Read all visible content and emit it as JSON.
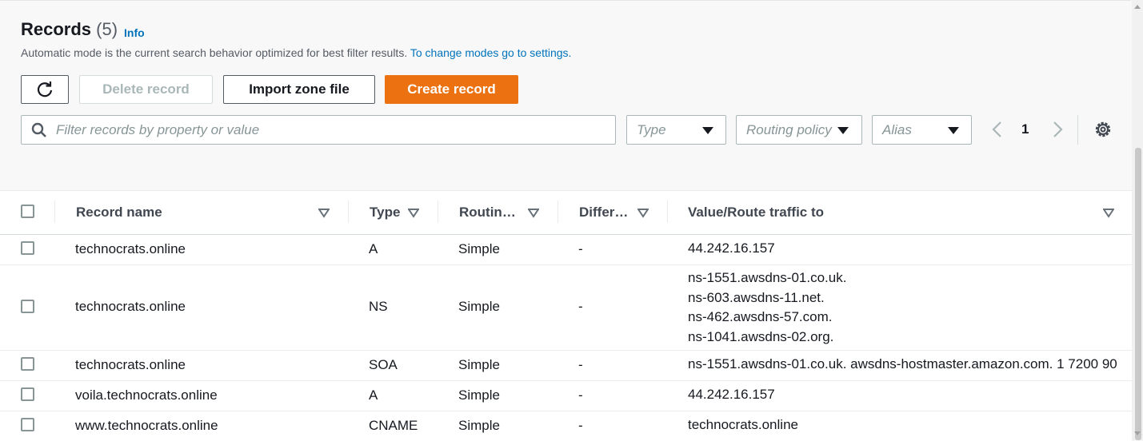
{
  "header": {
    "title": "Records",
    "count": "(5)",
    "info": "Info",
    "description": "Automatic mode is the current search behavior optimized for best filter results.",
    "settings_link": "To change modes go to settings."
  },
  "toolbar": {
    "refresh_icon": "refresh-icon",
    "delete_label": "Delete record",
    "import_label": "Import zone file",
    "create_label": "Create record"
  },
  "filters": {
    "search_placeholder": "Filter records by property or value",
    "type_placeholder": "Type",
    "routing_placeholder": "Routing policy",
    "alias_placeholder": "Alias"
  },
  "pagination": {
    "current_page": "1"
  },
  "colors": {
    "primary": "#ec7211",
    "link": "#0073bb",
    "disabled": "#aab7b8"
  },
  "table": {
    "columns": [
      "Record name",
      "Type",
      "Routin…",
      "Differ…",
      "Value/Route traffic to"
    ],
    "rows": [
      {
        "name": "technocrats.online",
        "type": "A",
        "routing": "Simple",
        "differ": "-",
        "values": [
          "44.242.16.157"
        ]
      },
      {
        "name": "technocrats.online",
        "type": "NS",
        "routing": "Simple",
        "differ": "-",
        "values": [
          "ns-1551.awsdns-01.co.uk.",
          "ns-603.awsdns-11.net.",
          "ns-462.awsdns-57.com.",
          "ns-1041.awsdns-02.org."
        ]
      },
      {
        "name": "technocrats.online",
        "type": "SOA",
        "routing": "Simple",
        "differ": "-",
        "values": [
          "ns-1551.awsdns-01.co.uk. awsdns-hostmaster.amazon.com. 1 7200 90"
        ]
      },
      {
        "name": "voila.technocrats.online",
        "type": "A",
        "routing": "Simple",
        "differ": "-",
        "values": [
          "44.242.16.157"
        ]
      },
      {
        "name": "www.technocrats.online",
        "type": "CNAME",
        "routing": "Simple",
        "differ": "-",
        "values": [
          "technocrats.online"
        ]
      }
    ]
  }
}
